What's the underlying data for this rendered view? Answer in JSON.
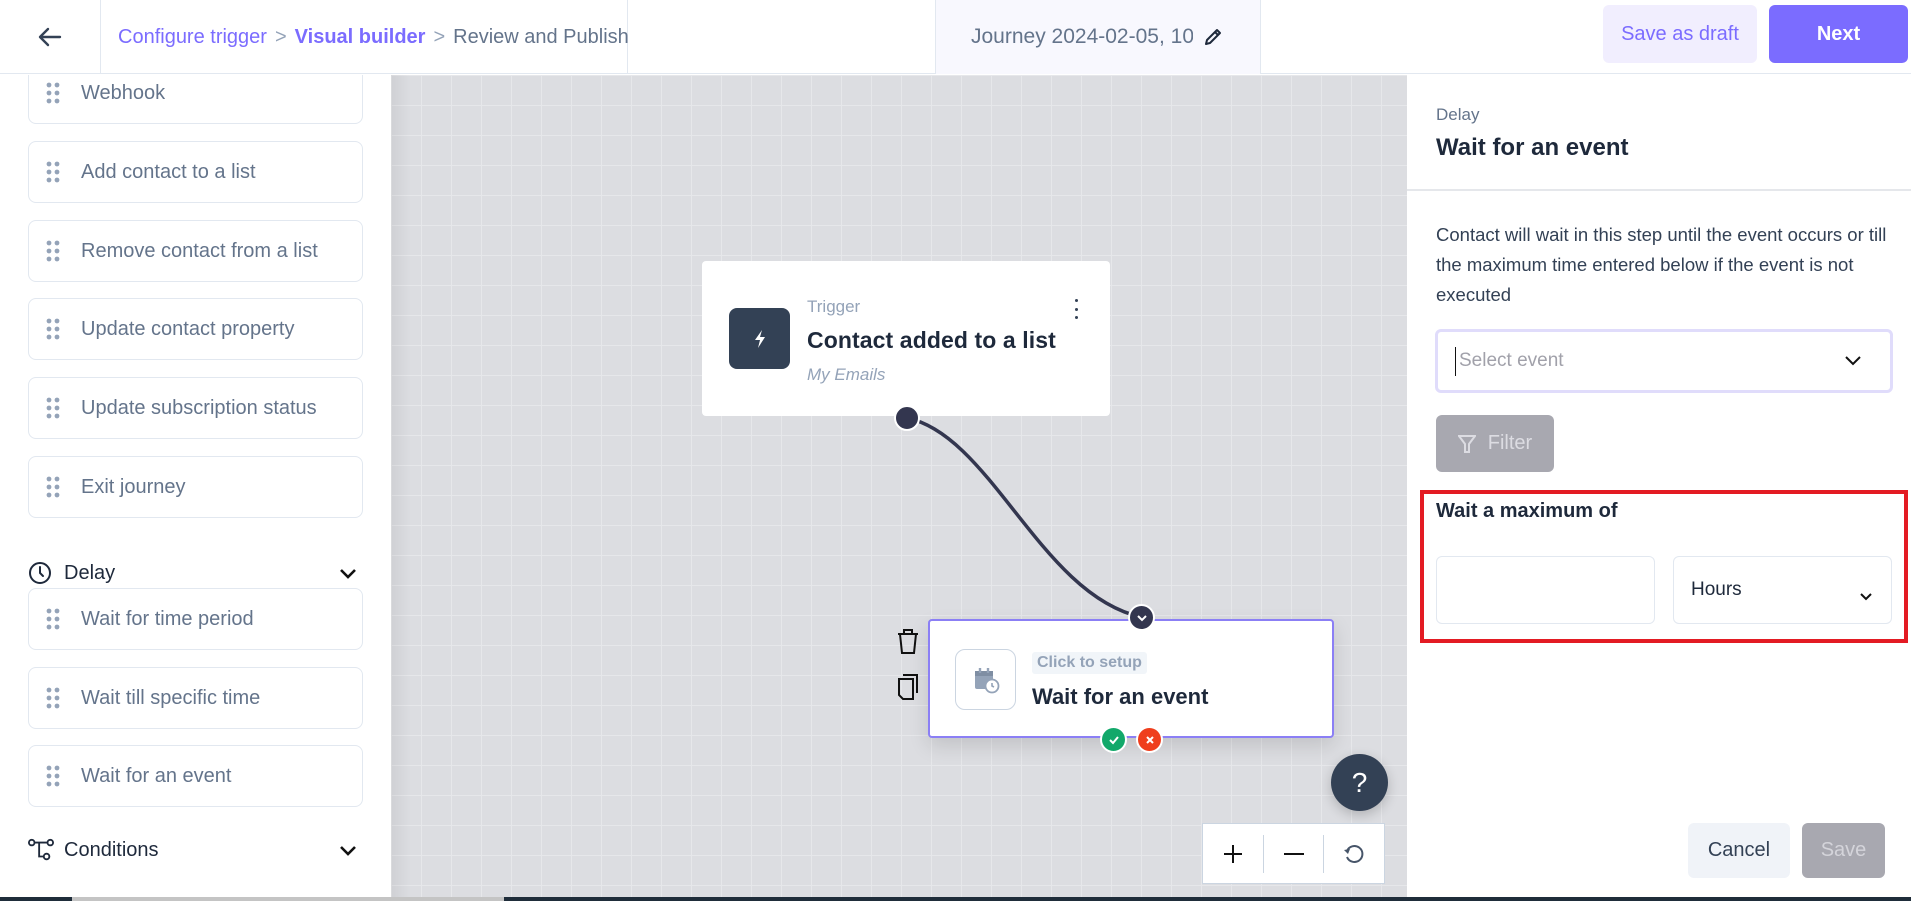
{
  "header": {
    "back_icon": "arrow-left-icon",
    "breadcrumb": [
      {
        "label": "Configure trigger",
        "state": "done"
      },
      {
        "label": "Visual builder",
        "state": "active"
      },
      {
        "label": "Review and Publish",
        "state": "pending"
      }
    ],
    "separator": ">",
    "journey_name": "Journey 2024-02-05, 10",
    "edit_icon": "pencil-icon",
    "save_draft_label": "Save as draft",
    "next_label": "Next"
  },
  "sidebar": {
    "action_items": [
      {
        "label": "Webhook"
      },
      {
        "label": "Add contact to a list"
      },
      {
        "label": "Remove contact from a list"
      },
      {
        "label": "Update contact property"
      },
      {
        "label": "Update subscription status"
      },
      {
        "label": "Exit journey"
      }
    ],
    "delay_section": {
      "label": "Delay",
      "icon": "clock-icon",
      "expanded": true,
      "items": [
        {
          "label": "Wait for time period"
        },
        {
          "label": "Wait till specific time"
        },
        {
          "label": "Wait for an event"
        }
      ]
    },
    "conditions_section": {
      "label": "Conditions",
      "icon": "branch-icon",
      "expanded": false
    }
  },
  "canvas": {
    "trigger": {
      "label": "Trigger",
      "title": "Contact added to a list",
      "subtitle": "My Emails",
      "icon": "lightning-icon"
    },
    "node": {
      "badge": "Click to setup",
      "title": "Wait for an event",
      "icon": "calendar-clock-icon"
    },
    "help_label": "?",
    "zoom_controls": {
      "zoom_in": "+",
      "zoom_out": "−",
      "reset_icon": "refresh-icon"
    }
  },
  "panel": {
    "category": "Delay",
    "title": "Wait for an event",
    "description": "Contact will wait in this step until the event occurs or till the maximum time entered below if the event is not executed",
    "event_select": {
      "placeholder": "Select event",
      "value": ""
    },
    "filter_label": "Filter",
    "max_label": "Wait a maximum of",
    "max_value": "",
    "unit_selected": "Hours",
    "cancel_label": "Cancel",
    "save_label": "Save"
  },
  "colors": {
    "accent": "#7b6cff",
    "dark": "#334155",
    "highlight_box": "#e31b23",
    "success": "#12a86a",
    "danger": "#ef3e1d"
  }
}
